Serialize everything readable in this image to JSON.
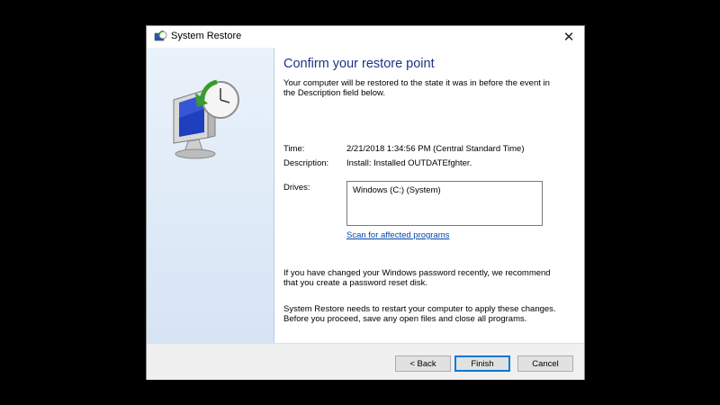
{
  "window": {
    "title": "System Restore",
    "close_glyph": "✕"
  },
  "content": {
    "heading": "Confirm your restore point",
    "subtitle": "Your computer will be restored to the state it was in before the event in the Description field below.",
    "time_label": "Time:",
    "time_value": "2/21/2018 1:34:56 PM (Central Standard Time)",
    "description_label": "Description:",
    "description_value": "Install: Installed OUTDATEfghter.",
    "drives_label": "Drives:",
    "drives": [
      "Windows (C:) (System)"
    ],
    "scan_link": "Scan for affected programs",
    "password_note": "If you have changed your Windows password recently, we recommend that you create a password reset disk.",
    "restart_note": "System Restore needs to restart your computer to apply these changes. Before you proceed, save any open files and close all programs."
  },
  "buttons": {
    "back": "< Back",
    "finish": "Finish",
    "cancel": "Cancel"
  },
  "icons": {
    "title": "system-restore-icon",
    "hero": "system-restore-clock-monitor-icon",
    "close": "close-icon"
  },
  "colors": {
    "heading": "#1e3287",
    "link": "#0645ad",
    "sidebar": "#dfe9f5",
    "accent": "#0078d7"
  }
}
